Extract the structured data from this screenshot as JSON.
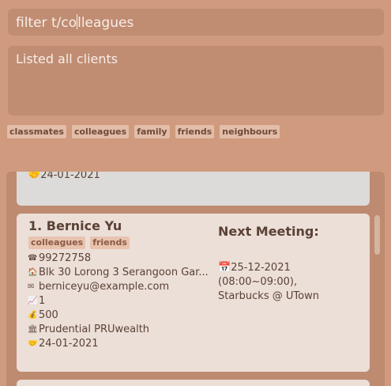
{
  "command": {
    "before_caret": "filter t/co",
    "after_caret": "lleagues"
  },
  "result": {
    "text": "Listed all clients"
  },
  "tag_filters": [
    "classmates",
    "colleagues",
    "family",
    "friends",
    "neighbours"
  ],
  "previous_card": {
    "last_meeting": "24-01-2021"
  },
  "client_card": {
    "title": "1.  Bernice Yu",
    "tags": [
      "colleagues",
      "friends"
    ],
    "phone": "99272758",
    "address": "Blk 30 Lorong 3 Serangoon Gar...",
    "email": "berniceyu@example.com",
    "risk": "1",
    "income": "500",
    "policy": "Prudential PRUwealth",
    "last_met": "24-01-2021",
    "next_meeting_label": "Next Meeting:",
    "next_meeting_time": "25-12-2021 (08:00~09:00),",
    "next_meeting_location": "Starbucks @ UTown"
  }
}
